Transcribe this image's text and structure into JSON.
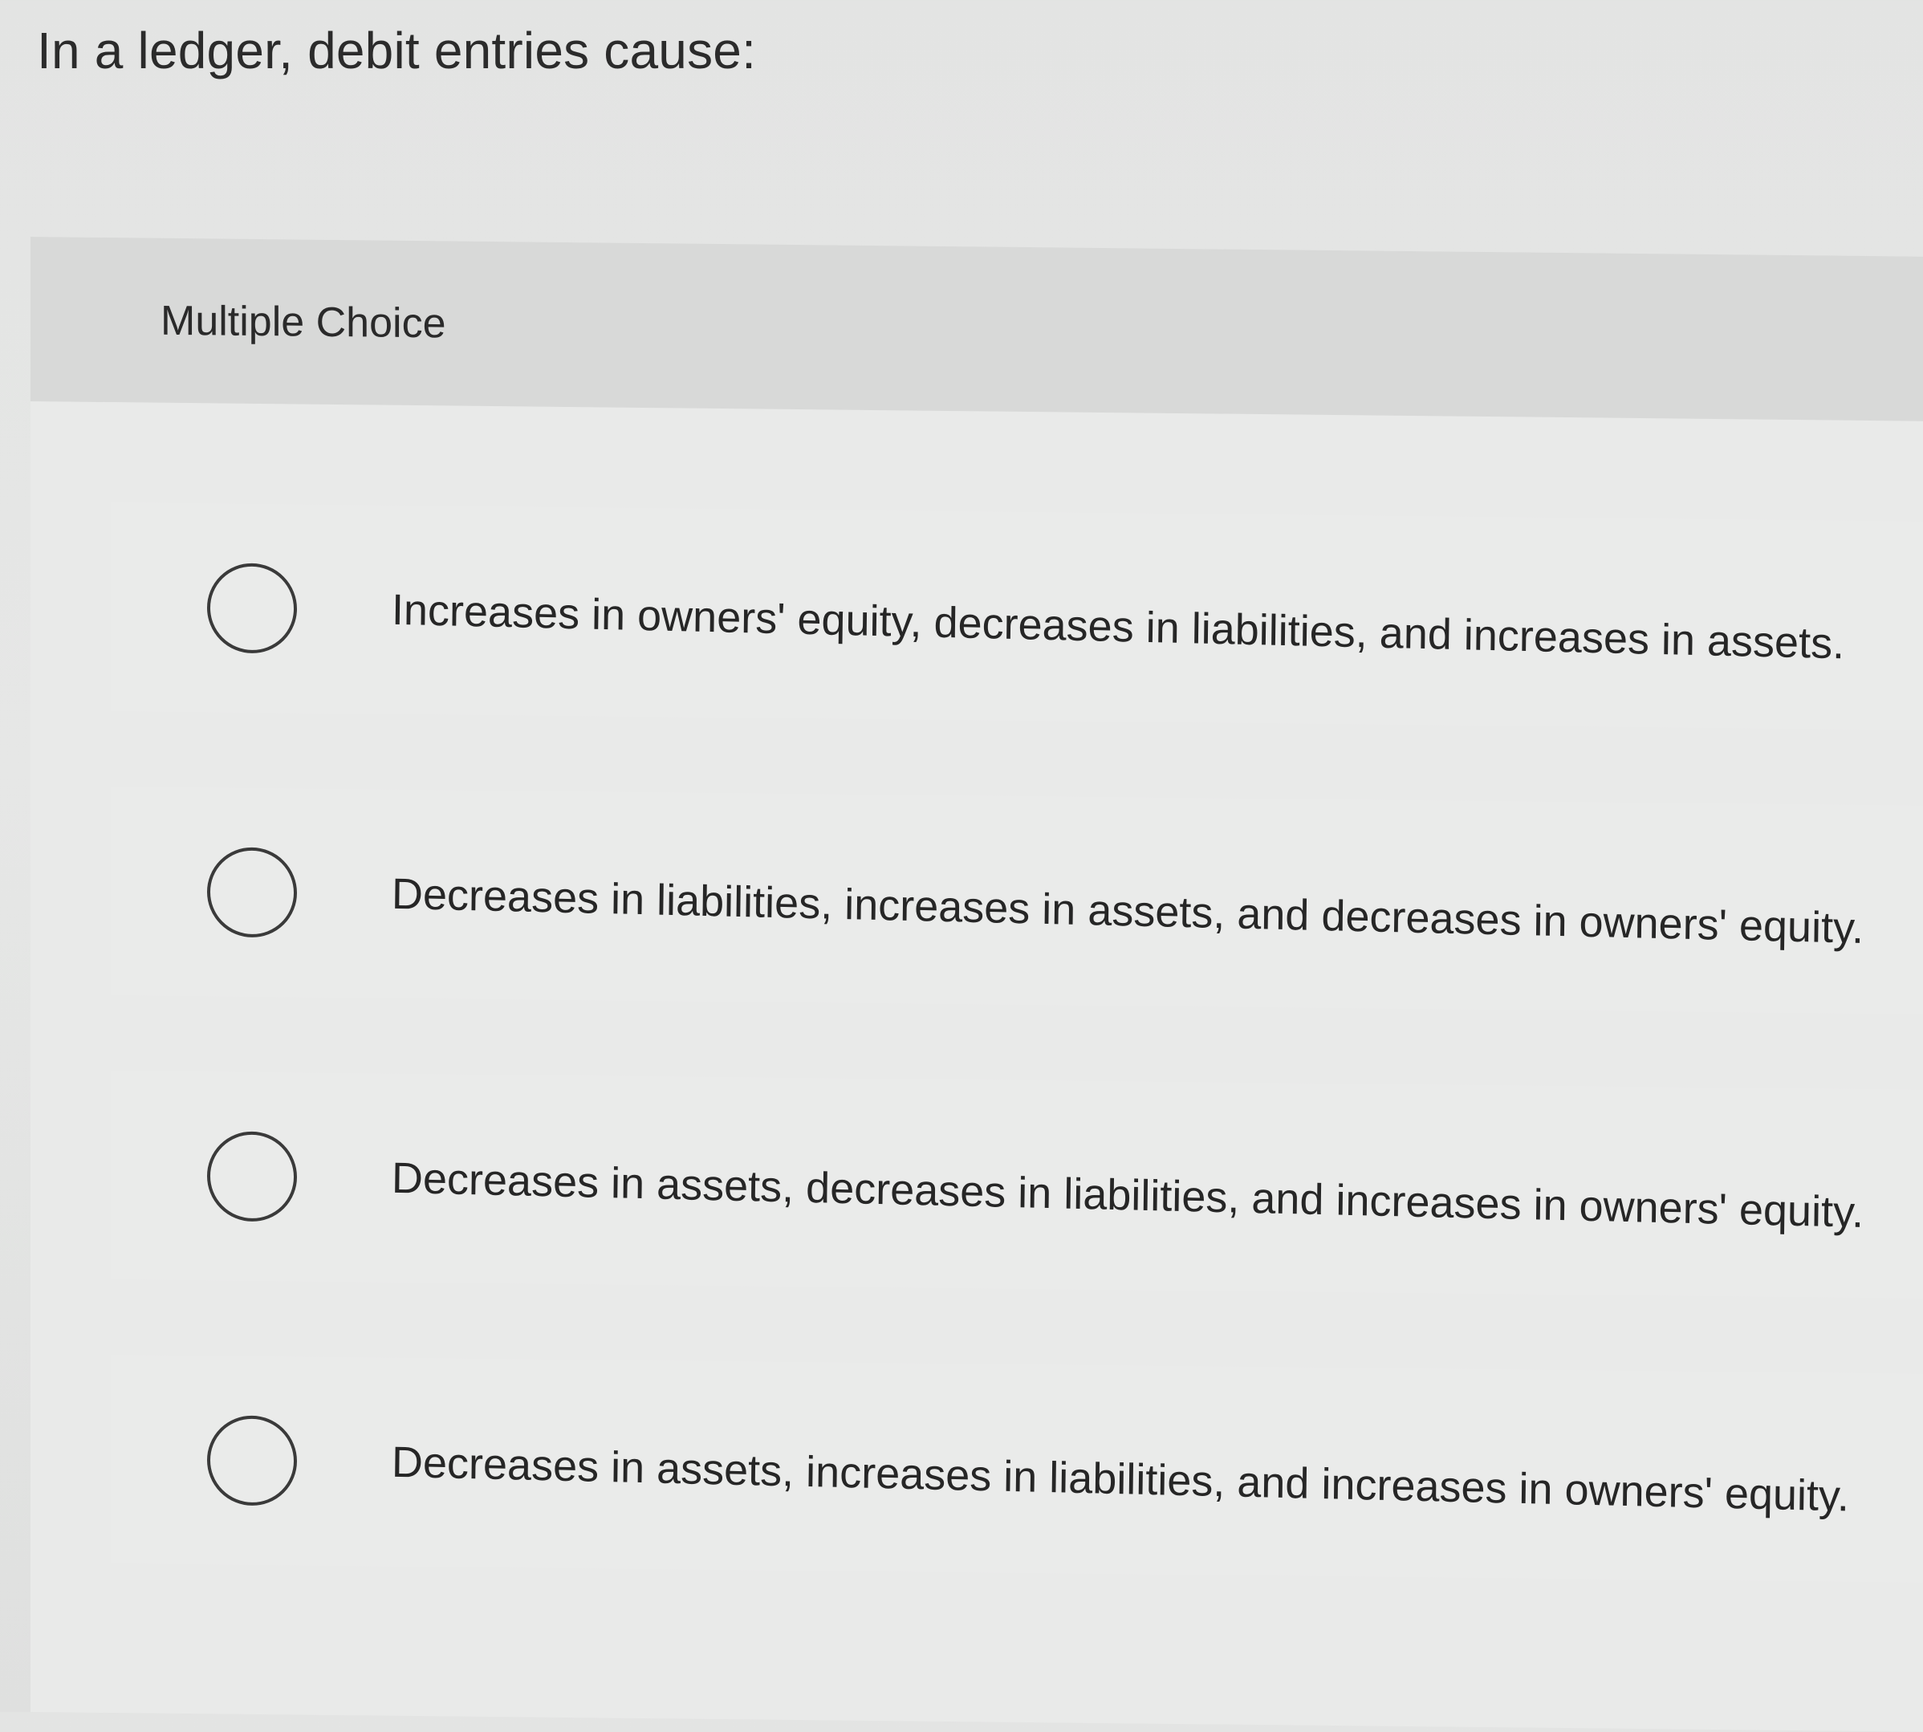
{
  "question": {
    "text": "In a ledger, debit entries cause:"
  },
  "panel": {
    "label": "Multiple Choice"
  },
  "options": [
    {
      "text": "Increases in owners' equity, decreases in liabilities, and increases in assets."
    },
    {
      "text": "Decreases in liabilities, increases in assets, and decreases in owners' equity."
    },
    {
      "text": "Decreases in assets, decreases in liabilities, and increases in owners' equity."
    },
    {
      "text": "Decreases in assets, increases in liabilities, and increases in owners' equity."
    }
  ]
}
